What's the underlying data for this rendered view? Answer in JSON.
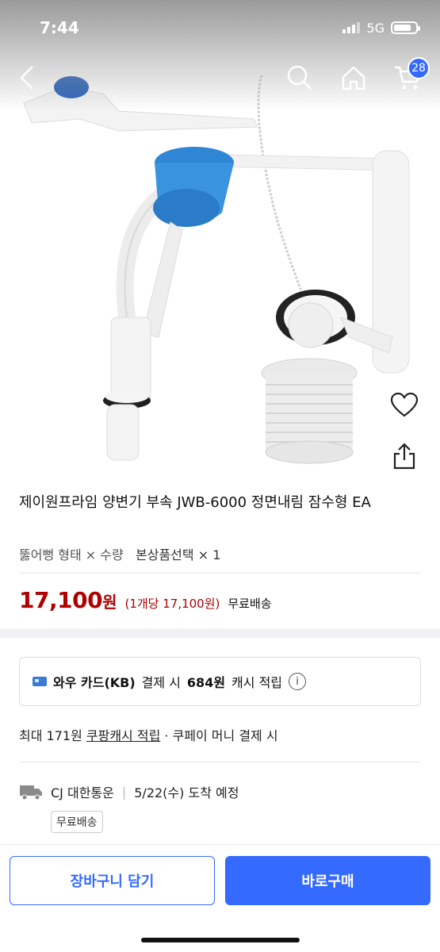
{
  "status_bar": {
    "time": "7:44",
    "network": "5G"
  },
  "nav": {
    "cart_count": "28"
  },
  "product": {
    "title": "제이원프라임 양변기 부속 JWB-6000 정면내림 잠수형 EA",
    "option_label": "뚫어뻥 형태",
    "option_sep": "×",
    "option_qty_label": "수량",
    "option_value": "본상품선택",
    "option_qty": "× 1",
    "price": "17,100",
    "price_unit": "원",
    "unit_price": "(1개당 17,100원)",
    "shipping": "무료배송"
  },
  "card_benefit": {
    "prefix": "와우 카드(KB)",
    "mid": "결제 시",
    "amount": "684원",
    "suffix": "캐시 적립",
    "info_glyph": "i"
  },
  "cash": {
    "prefix": "최대 171원",
    "link": "쿠팡캐시 적립",
    "suffix": "· 쿠페이 머니 결제 시"
  },
  "delivery": {
    "carrier": "CJ 대한통운",
    "sep": "|",
    "eta": "5/22(수) 도착 예정",
    "tag": "무료배송"
  },
  "actions": {
    "cart": "장바구니 담기",
    "buy": "바로구매"
  },
  "icons": [
    "back-icon",
    "search-icon",
    "home-icon",
    "cart-icon",
    "heart-icon",
    "share-icon",
    "truck-icon",
    "card-icon",
    "info-icon"
  ],
  "colors": {
    "accent": "#346aff",
    "price": "#ae0000"
  }
}
